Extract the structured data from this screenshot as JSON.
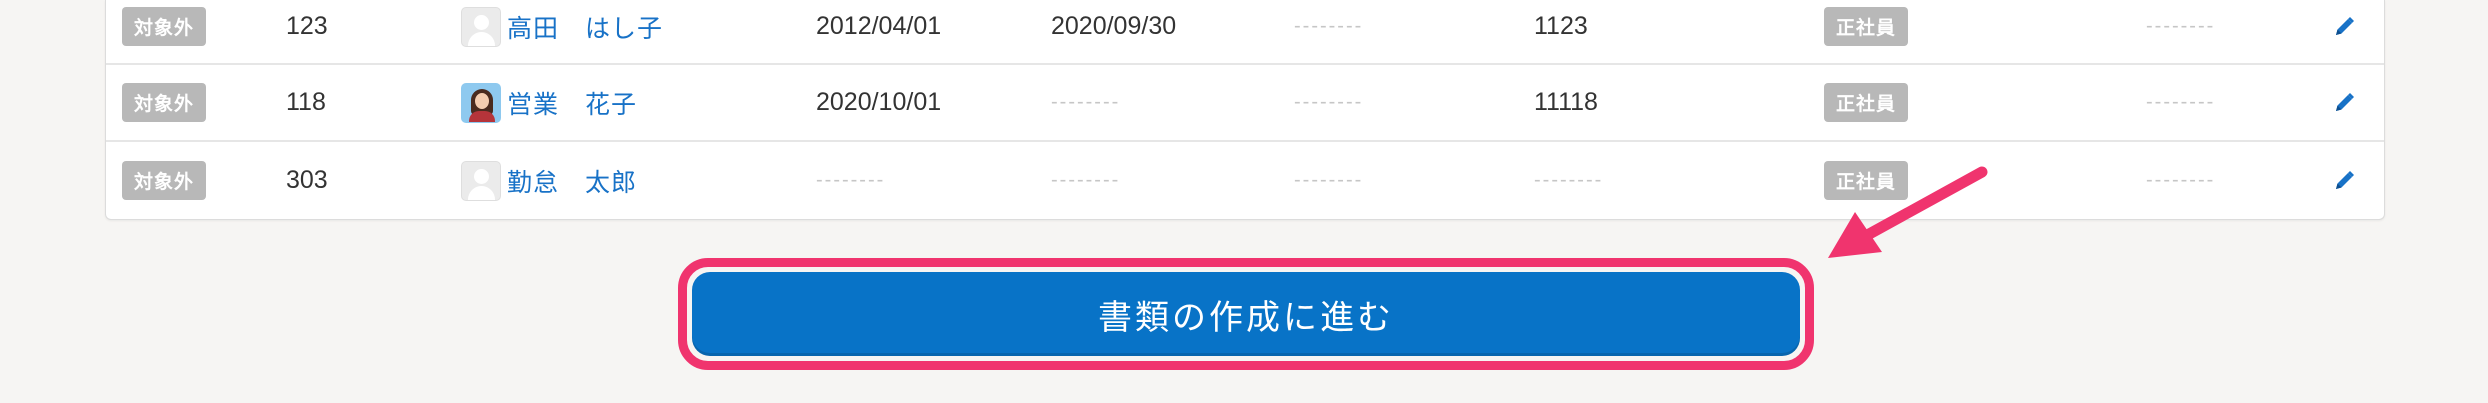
{
  "rows": [
    {
      "status": "対象外",
      "id": "123",
      "name": "高田　はし子",
      "avatar": "placeholder",
      "hire_date": "2012/04/01",
      "leave_date": "2020/09/30",
      "col6": "--------",
      "code": "1123",
      "employment_type": "正社員",
      "col9": "--------"
    },
    {
      "status": "対象外",
      "id": "118",
      "name": "営業　花子",
      "avatar": "photo",
      "hire_date": "2020/10/01",
      "leave_date": "--------",
      "col6": "--------",
      "code": "11118",
      "employment_type": "正社員",
      "col9": "--------"
    },
    {
      "status": "対象外",
      "id": "303",
      "name": "勤怠　太郎",
      "avatar": "placeholder",
      "hire_date": "--------",
      "leave_date": "--------",
      "col6": "--------",
      "code": "--------",
      "employment_type": "正社員",
      "col9": "--------"
    }
  ],
  "submit_label": "書類の作成に進む",
  "icons": {
    "edit": "pencil-icon",
    "avatar": "user-avatar-icon",
    "annotation": "arrow-pointer-icon"
  },
  "colors": {
    "accent": "#0873c7",
    "highlight": "#f0346e",
    "badge": "#b8b8b8",
    "link": "#1872c7"
  }
}
